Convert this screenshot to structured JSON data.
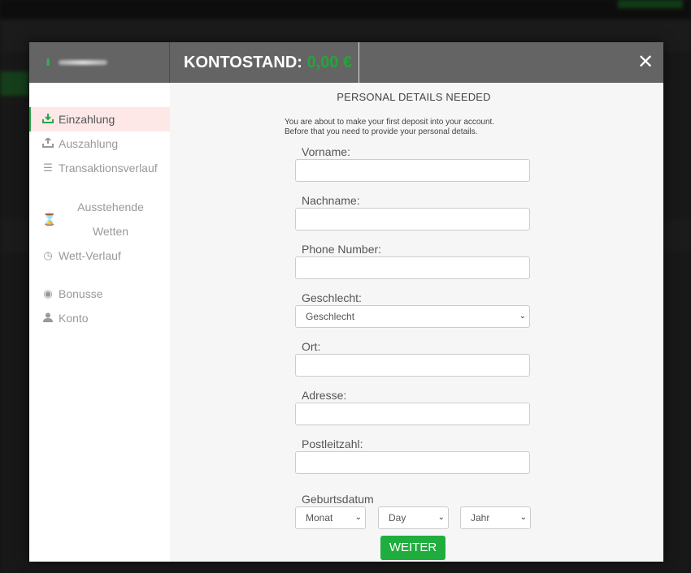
{
  "header": {
    "balance_label": "KONTOSTAND:",
    "balance_amount": "0,00 €",
    "close_label": "✕"
  },
  "sidebar": {
    "items": [
      {
        "label": "Einzahlung",
        "icon": "download-tray-icon"
      },
      {
        "label": "Auszahlung",
        "icon": "upload-tray-icon"
      },
      {
        "label": "Transaktionsverlauf",
        "icon": "list-icon"
      },
      {
        "label_line1": "Ausstehende",
        "label_line2": "Wetten",
        "icon": "hourglass-icon"
      },
      {
        "label": "Wett-Verlauf",
        "icon": "clock-icon"
      },
      {
        "label": "Bonusse",
        "icon": "bonus-icon"
      },
      {
        "label": "Konto",
        "icon": "user-icon"
      }
    ]
  },
  "form": {
    "title": "PERSONAL DETAILS NEEDED",
    "intro_line1": "You are about to make your first deposit into your account.",
    "intro_line2": "Before that you need to provide your personal details.",
    "vorname_label": "Vorname:",
    "nachname_label": "Nachname:",
    "phone_label": "Phone Number:",
    "geschlecht_label": "Geschlecht:",
    "geschlecht_value": "Geschlecht",
    "ort_label": "Ort:",
    "adresse_label": "Adresse:",
    "plz_label": "Postleitzahl:",
    "geburtsdatum_label": "Geburtsdatum",
    "monat_value": "Monat",
    "day_value": "Day",
    "jahr_value": "Jahr",
    "submit_label": "WEITER"
  },
  "colors": {
    "accent_green": "#1fae3d",
    "header_gray": "#646464",
    "active_bg": "#fde7e7"
  }
}
